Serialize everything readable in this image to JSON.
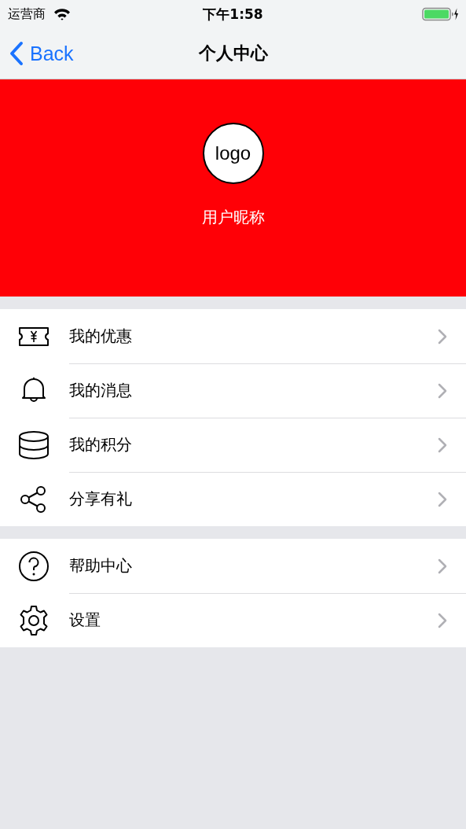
{
  "status_bar": {
    "carrier": "运营商",
    "time": "下午1:58"
  },
  "nav_bar": {
    "back": "Back",
    "title": "个人中心"
  },
  "profile": {
    "logo": "logo",
    "nickname": "用户昵称"
  },
  "sections": [
    {
      "items": [
        {
          "kind": "ticket",
          "label": "我的优惠"
        },
        {
          "kind": "bell",
          "label": "我的消息"
        },
        {
          "kind": "database",
          "label": "我的积分"
        },
        {
          "kind": "share",
          "label": "分享有礼"
        }
      ]
    },
    {
      "items": [
        {
          "kind": "help",
          "label": "帮助中心"
        },
        {
          "kind": "gear",
          "label": "设置"
        }
      ]
    }
  ]
}
